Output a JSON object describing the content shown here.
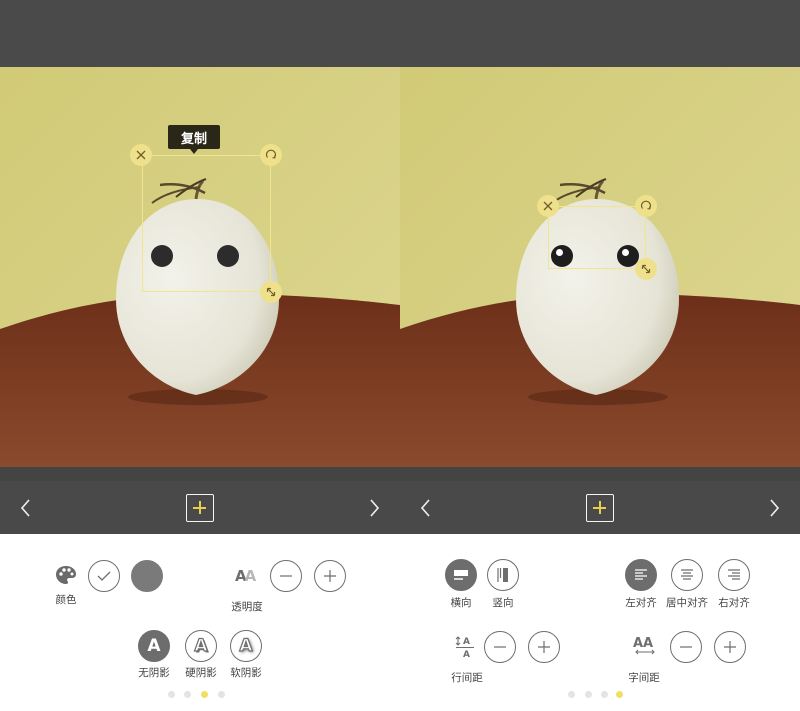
{
  "left_panel": {
    "tooltip": "复制",
    "tools": {
      "color_label": "颜色",
      "opacity_label": "透明度",
      "no_shadow_label": "无阴影",
      "hard_shadow_label": "硬阴影",
      "soft_shadow_label": "软阴影",
      "shadow_glyph": "A"
    },
    "page_dots": {
      "count": 4,
      "active_index": 2
    }
  },
  "right_panel": {
    "tools": {
      "horizontal_label": "横向",
      "vertical_label": "竖向",
      "align_left_label": "左对齐",
      "align_center_label": "居中对齐",
      "align_right_label": "右对齐",
      "line_spacing_label": "行间距",
      "letter_spacing_label": "字间距"
    },
    "page_dots": {
      "count": 4,
      "active_index": 3
    }
  },
  "colors": {
    "topbar": "#4a4a4a",
    "navbar": "#494949",
    "accent_yellow": "#e8cf4f",
    "selection_yellow": "#f2e58f",
    "wall": "#d3cd7c",
    "table": "#7a3b22",
    "selected_color_swatch": "#7a7a7a"
  },
  "icons": {
    "nav_prev": "chevron-left-icon",
    "nav_next": "chevron-right-icon",
    "nav_add": "plus-icon",
    "close_handle": "close-icon",
    "rotate_handle": "rotate-icon",
    "resize_handle": "resize-icon",
    "palette": "palette-icon",
    "check": "check-icon",
    "opacity": "opacity-icon",
    "minus": "minus-icon",
    "plus": "plus-icon"
  }
}
